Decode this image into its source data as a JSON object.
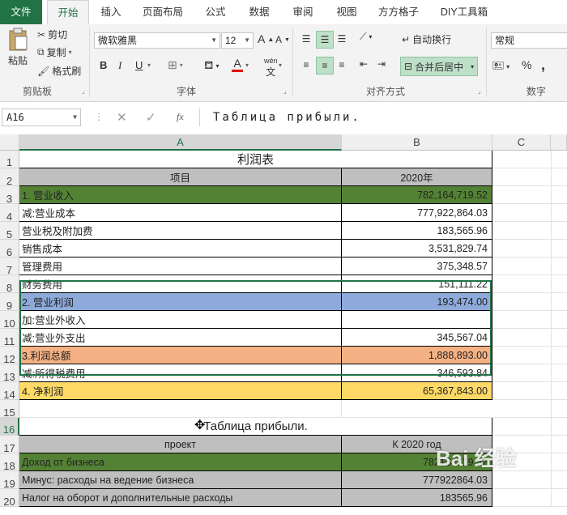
{
  "tabs": [
    "文件",
    "开始",
    "插入",
    "页面布局",
    "公式",
    "数据",
    "审阅",
    "视图",
    "方方格子",
    "DIY工具箱"
  ],
  "ribbon": {
    "paste": "粘贴",
    "cut": "剪切",
    "copy": "复制",
    "format_painter": "格式刷",
    "clipboard_label": "剪贴板",
    "font_name": "微软雅黑",
    "font_size": "12",
    "font_label": "字体",
    "wrap_text": "自动换行",
    "merge_center": "合并后居中",
    "alignment_label": "对齐方式",
    "number_format": "常规",
    "number_label": "数字",
    "bold": "B",
    "italic": "I",
    "underline": "U",
    "grow_font": "A",
    "shrink_font": "A",
    "font_color": "A",
    "phonetic": "wén",
    "percent": "%",
    "comma": ","
  },
  "formula_bar": {
    "name_box": "A16",
    "fx": "fx",
    "content": "Таблица прибыли."
  },
  "columns": [
    "A",
    "B",
    "C"
  ],
  "rows": [
    {
      "n": "1",
      "a": "利润表",
      "b": "",
      "kind": "title"
    },
    {
      "n": "2",
      "a": "项目",
      "b": "2020年",
      "kind": "header"
    },
    {
      "n": "3",
      "a": "1. 营业收入",
      "b": "782,164,719.52",
      "kind": "green"
    },
    {
      "n": "4",
      "a": "减:营业成本",
      "b": "777,922,864.03",
      "kind": "plain"
    },
    {
      "n": "5",
      "a": "营业税及附加费",
      "b": "183,565.96",
      "kind": "plain"
    },
    {
      "n": "6",
      "a": "销售成本",
      "b": "3,531,829.74",
      "kind": "plain"
    },
    {
      "n": "7",
      "a": "管理费用",
      "b": "375,348.57",
      "kind": "plain"
    },
    {
      "n": "8",
      "a": "财务费用",
      "b": "151,111.22",
      "kind": "plain"
    },
    {
      "n": "9",
      "a": "2. 营业利润",
      "b": "193,474.00",
      "kind": "blue"
    },
    {
      "n": "10",
      "a": "加:营业外收入",
      "b": "",
      "kind": "plain"
    },
    {
      "n": "11",
      "a": "减:营业外支出",
      "b": "345,567.04",
      "kind": "plain"
    },
    {
      "n": "12",
      "a": "3.利润总额",
      "b": "1,888,893.00",
      "kind": "orange"
    },
    {
      "n": "13",
      "a": "减:所得税费用",
      "b": "346,593.84",
      "kind": "plain"
    },
    {
      "n": "14",
      "a": "4. 净利润",
      "b": "65,367,843.00",
      "kind": "yellow"
    },
    {
      "n": "15",
      "a": "",
      "b": "",
      "kind": "empty"
    },
    {
      "n": "16",
      "a": "Таблица прибыли.",
      "b": "",
      "kind": "title"
    },
    {
      "n": "17",
      "a": "проект",
      "b": "К 2020 год",
      "kind": "header"
    },
    {
      "n": "18",
      "a": "Доход от бизнеса",
      "b": "782164719.52",
      "kind": "green"
    },
    {
      "n": "19",
      "a": "Минус: расходы на ведение бизнеса",
      "b": "777922864.03",
      "kind": "gray"
    },
    {
      "n": "20",
      "a": "Налог на оборот и дополнительные расходы",
      "b": "183565.96",
      "kind": "gray"
    }
  ],
  "watermark": "Bai 经验",
  "colors": {
    "accent": "#217346",
    "green": "#548235",
    "blue": "#8eaadb",
    "orange": "#f4b183",
    "yellow": "#ffd966",
    "gray": "#bfbfbf",
    "header": "#bfbfbf"
  }
}
